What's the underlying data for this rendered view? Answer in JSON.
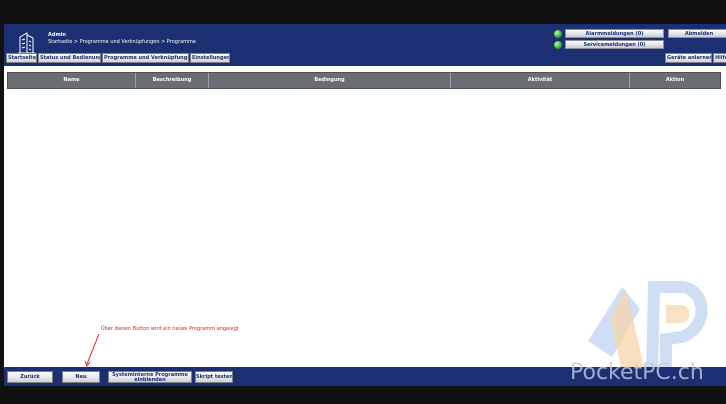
{
  "header": {
    "user": "Admin",
    "breadcrumb": "Startseite > Programme und Verknüpfungen > Programme",
    "alarm_button": "Alarmmeldungen (0)",
    "service_button": "Servicemeldungen (0)",
    "logout_button": "Abmelden"
  },
  "nav": {
    "tabs": [
      {
        "label": "Startseite"
      },
      {
        "label": "Status und Bedienung"
      },
      {
        "label": "Programme und Verknüpfungen"
      },
      {
        "label": "Einstellungen"
      }
    ],
    "teach_button": "Geräte anlernen",
    "help_button": "Hilfe"
  },
  "table": {
    "columns": [
      "Name",
      "Beschreibung",
      "Bedingung",
      "Aktivität",
      "Aktion"
    ]
  },
  "annotation": "Über diesen Button wird ein neues Programm angelegt",
  "footer": {
    "back": "Zurück",
    "new": "Neu",
    "system_line1": "Systeminterne Programme",
    "system_line2": "einblenden",
    "test_script": "Skript testen"
  },
  "watermark": "PocketPC.ch",
  "colors": {
    "header_bg": "#1d2f73",
    "table_head_bg": "#6a6e73",
    "annotation": "#e11b1b",
    "led": "#2fae2f"
  }
}
